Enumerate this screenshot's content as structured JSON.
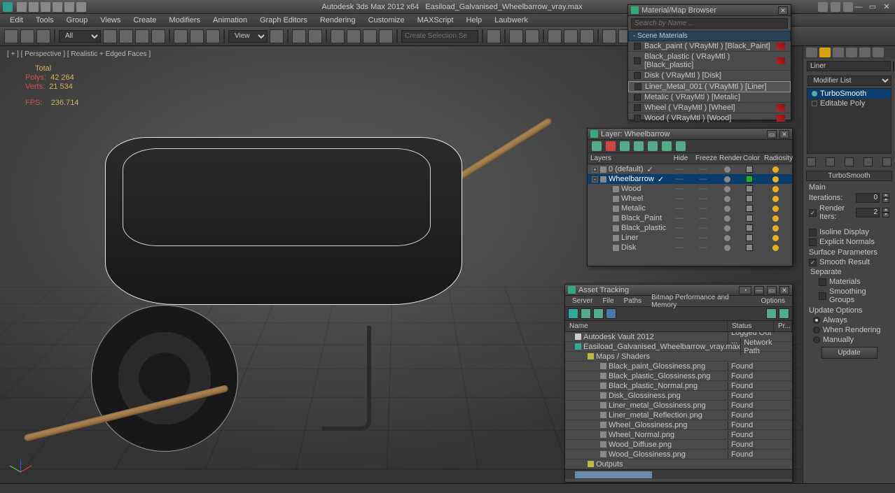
{
  "app": {
    "title_left": "Autodesk 3ds Max  2012 x64",
    "title_file": "Easiload_Galvanised_Wheelbarrow_vray.max"
  },
  "menu": [
    "Edit",
    "Tools",
    "Group",
    "Views",
    "Create",
    "Modifiers",
    "Animation",
    "Graph Editors",
    "Rendering",
    "Customize",
    "MAXScript",
    "Help",
    "Laubwerk"
  ],
  "toolbar": {
    "selset_placeholder": "Create Selection Se",
    "filter_all": "All",
    "view_label": "View"
  },
  "viewport": {
    "label": "[ + ] [ Perspective ] [ Realistic + Edged Faces ]",
    "stats": {
      "total": "Total",
      "polys_label": "Polys:",
      "polys": "42 264",
      "verts_label": "Verts:",
      "verts": "21 534",
      "fps_label": "FPS:",
      "fps": "236.714"
    }
  },
  "cmd": {
    "obj_name": "Liner",
    "modlist_label": "Modifier List",
    "stack": [
      "TurboSmooth",
      "Editable Poly"
    ],
    "rollout": "TurboSmooth",
    "main": "Main",
    "iter_label": "Iterations:",
    "iter_val": "0",
    "rend_label": "Render Iters:",
    "rend_val": "2",
    "isoline": "Isoline Display",
    "explicit": "Explicit Normals",
    "surf": "Surface Parameters",
    "smooth": "Smooth Result",
    "separate": "Separate",
    "sep_mat": "Materials",
    "sep_smg": "Smoothing Groups",
    "update": "Update Options",
    "u_always": "Always",
    "u_render": "When Rendering",
    "u_manual": "Manually",
    "update_btn": "Update"
  },
  "matbrowser": {
    "title": "Material/Map Browser",
    "search": "Search by Name ...",
    "section": "- Scene Materials",
    "items": [
      {
        "label": "Back_paint ( VRayMtl ) [Black_Paint]",
        "warn": true
      },
      {
        "label": "Black_plastic ( VRayMtl ) [Black_plastic]",
        "warn": true
      },
      {
        "label": "Disk ( VRayMtl ) [Disk]",
        "warn": false
      },
      {
        "label": "Liner_Metal_001 ( VRayMtl ) [Liner]",
        "warn": false,
        "sel": true
      },
      {
        "label": "Metalic ( VRayMtl ) [Metalic]",
        "warn": false
      },
      {
        "label": "Wheel ( VRayMtl ) [Wheel]",
        "warn": true
      },
      {
        "label": "Wood ( VRayMtl ) [Wood]",
        "warn": true
      }
    ]
  },
  "layers": {
    "title": "Layer: Wheelbarrow",
    "cols": {
      "name": "Layers",
      "hide": "Hide",
      "freeze": "Freeze",
      "render": "Render",
      "color": "Color",
      "rad": "Radiosity"
    },
    "rows": [
      {
        "name": "0 (default)",
        "check": true,
        "depth": 0,
        "exp": "+",
        "color": "#888"
      },
      {
        "name": "Wheelbarrow",
        "sel": true,
        "check": true,
        "depth": 0,
        "exp": "-",
        "color": "#1db41d"
      },
      {
        "name": "Wood",
        "depth": 1,
        "color": "#888"
      },
      {
        "name": "Wheel",
        "depth": 1,
        "color": "#888"
      },
      {
        "name": "Metalic",
        "depth": 1,
        "color": "#888"
      },
      {
        "name": "Black_Paint",
        "depth": 1,
        "color": "#888"
      },
      {
        "name": "Black_plastic",
        "depth": 1,
        "color": "#888"
      },
      {
        "name": "Liner",
        "depth": 1,
        "color": "#888"
      },
      {
        "name": "Disk",
        "depth": 1,
        "color": "#888"
      }
    ]
  },
  "assets": {
    "title": "Asset Tracking",
    "menu": [
      "Server",
      "File",
      "Paths",
      "Bitmap Performance and Memory",
      "Options"
    ],
    "cols": {
      "name": "Name",
      "status": "Status",
      "pr": "Pr..."
    },
    "rows": [
      {
        "name": "Autodesk Vault 2012",
        "status": "Logged Out ...",
        "depth": 0,
        "icon": "#ccc"
      },
      {
        "name": "Easiload_Galvanised_Wheelbarrow_vray.max",
        "status": "Network Path",
        "depth": 0,
        "icon": "#3a9"
      },
      {
        "name": "Maps / Shaders",
        "status": "",
        "depth": 1,
        "icon": "#bb4"
      },
      {
        "name": "Black_paint_Glossiness.png",
        "status": "Found",
        "depth": 2
      },
      {
        "name": "Black_plastic_Glossiness.png",
        "status": "Found",
        "depth": 2
      },
      {
        "name": "Black_plastic_Normal.png",
        "status": "Found",
        "depth": 2
      },
      {
        "name": "Disk_Glossiness.png",
        "status": "Found",
        "depth": 2
      },
      {
        "name": "Liner_metal_Glossiness.png",
        "status": "Found",
        "depth": 2
      },
      {
        "name": "Liner_metal_Reflection.png",
        "status": "Found",
        "depth": 2
      },
      {
        "name": "Wheel_Glossiness.png",
        "status": "Found",
        "depth": 2
      },
      {
        "name": "Wheel_Normal.png",
        "status": "Found",
        "depth": 2
      },
      {
        "name": "Wood_Diffuse.png",
        "status": "Found",
        "depth": 2
      },
      {
        "name": "Wood_Glossiness.png",
        "status": "Found",
        "depth": 2
      },
      {
        "name": "Outputs",
        "status": "",
        "depth": 1,
        "icon": "#bb4"
      }
    ]
  }
}
